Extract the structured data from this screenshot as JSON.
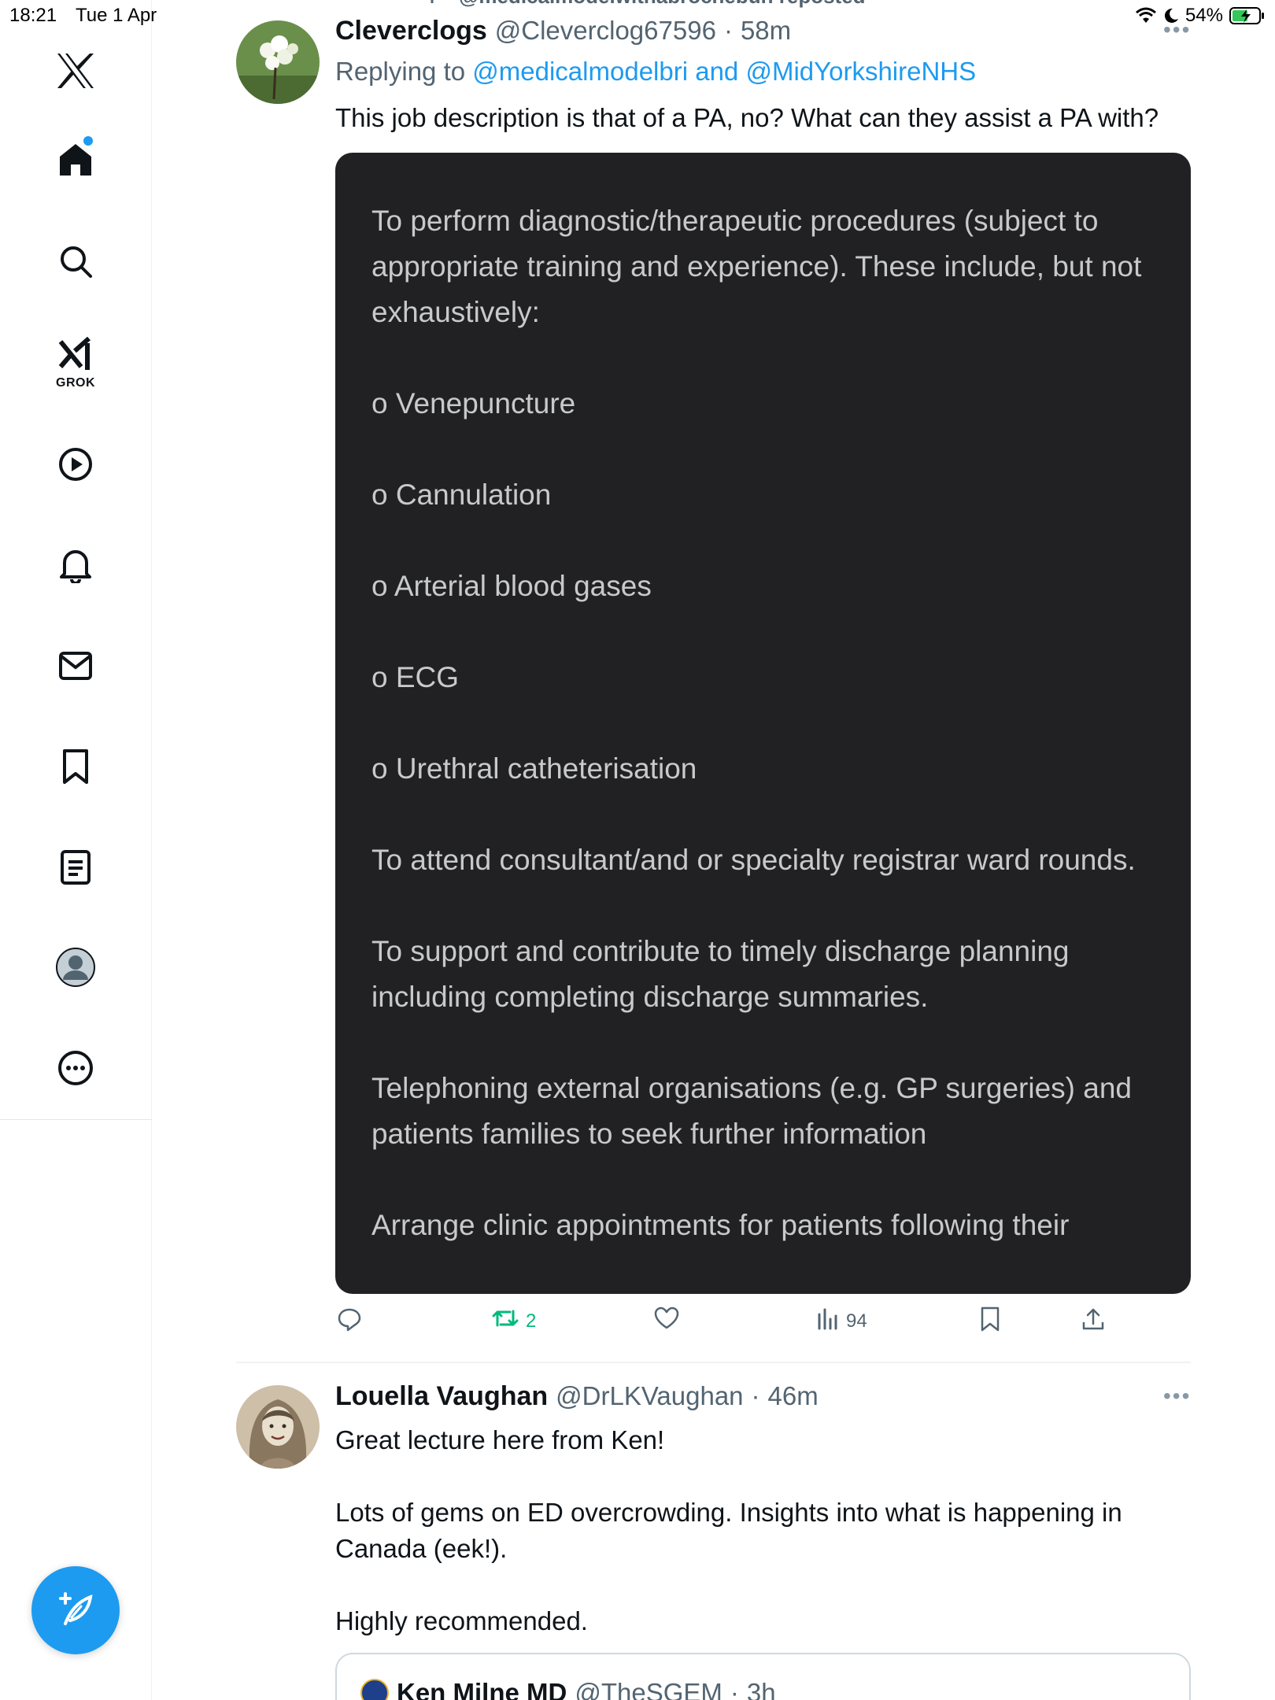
{
  "status_bar": {
    "time": "18:21",
    "date": "Tue 1 Apr",
    "battery": "54%"
  },
  "sidebar": {
    "grok_label": "GROK",
    "items": [
      "home",
      "search",
      "grok",
      "video",
      "notifications",
      "messages",
      "bookmarks",
      "lists",
      "profile",
      "more"
    ],
    "accent_color": "#1d9bf0"
  },
  "feed": {
    "repost_banner": "@medicalmodelwithabrochebun reposted",
    "tweets": [
      {
        "display_name": "Cleverclogs",
        "handle": "@Cleverclog67596",
        "separator": "·",
        "time": "58m",
        "replying_prefix": "Replying to",
        "mention_1": "@medicalmodelbri",
        "and_word": "and",
        "mention_2": "@MidYorkshireNHS",
        "text": "This job description is that of a PA, no? What can they assist a PA with?",
        "image_text": [
          "To perform diagnostic/therapeutic procedures (subject to appropriate training and experience). These include, but not exhaustively:",
          "o Venepuncture",
          "o Cannulation",
          "o Arterial blood gases",
          "o ECG",
          "o Urethral catheterisation",
          "To attend consultant/and or specialty registrar ward rounds.",
          "To support and contribute to timely discharge planning including completing discharge summaries.",
          "Telephoning external organisations (e.g. GP surgeries) and patients families to seek further information",
          "Arrange clinic appointments for patients following their"
        ],
        "reposts": "2",
        "views": "94"
      },
      {
        "display_name": "Louella Vaughan",
        "handle": "@DrLKVaughan",
        "separator": "·",
        "time": "46m",
        "text": "Great lecture here from Ken!\n\nLots of gems on ED overcrowding. Insights into what is happening in\nCanada (eek!).\n\nHighly recommended.",
        "quote": {
          "display_name": "Ken Milne MD",
          "handle": "@TheSGEM",
          "separator": "·",
          "time": "3h"
        }
      }
    ]
  }
}
